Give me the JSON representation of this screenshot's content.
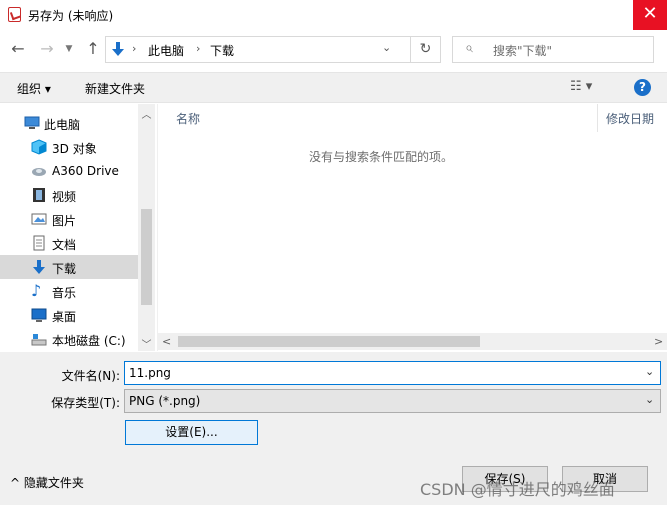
{
  "window": {
    "title": "另存为 (未响应)"
  },
  "address": {
    "crumbs": [
      "此电脑",
      "下载"
    ],
    "search_placeholder": "搜索\"下载\""
  },
  "toolbar": {
    "organize": "组织 ▾",
    "new_folder": "新建文件夹"
  },
  "nav": {
    "items": [
      {
        "label": "此电脑",
        "icon": "computer-icon"
      },
      {
        "label": "3D 对象",
        "icon": "cube-icon"
      },
      {
        "label": "A360 Drive",
        "icon": "cloud-drive-icon"
      },
      {
        "label": "视频",
        "icon": "film-icon"
      },
      {
        "label": "图片",
        "icon": "picture-icon"
      },
      {
        "label": "文档",
        "icon": "document-icon"
      },
      {
        "label": "下载",
        "icon": "download-arrow-icon",
        "selected": true
      },
      {
        "label": "音乐",
        "icon": "music-note-icon"
      },
      {
        "label": "桌面",
        "icon": "desktop-icon"
      },
      {
        "label": "本地磁盘 (C:)",
        "icon": "drive-icon"
      }
    ]
  },
  "filelist": {
    "columns": [
      "名称",
      "修改日期"
    ],
    "empty_message": "没有与搜索条件匹配的项。"
  },
  "form": {
    "filename_label": "文件名(N):",
    "filename_value": "11.png",
    "filetype_label": "保存类型(T):",
    "filetype_value": "PNG (*.png)",
    "settings_label": "设置(E)...",
    "hide_folders_label": "隐藏文件夹",
    "save_label": "保存(S)",
    "cancel_label": "取消"
  },
  "watermark": "CSDN @情寸进尺的鸡丝面",
  "colors": {
    "accent": "#0078d7",
    "close": "#e81123",
    "download_icon": "#1a6fc9"
  }
}
